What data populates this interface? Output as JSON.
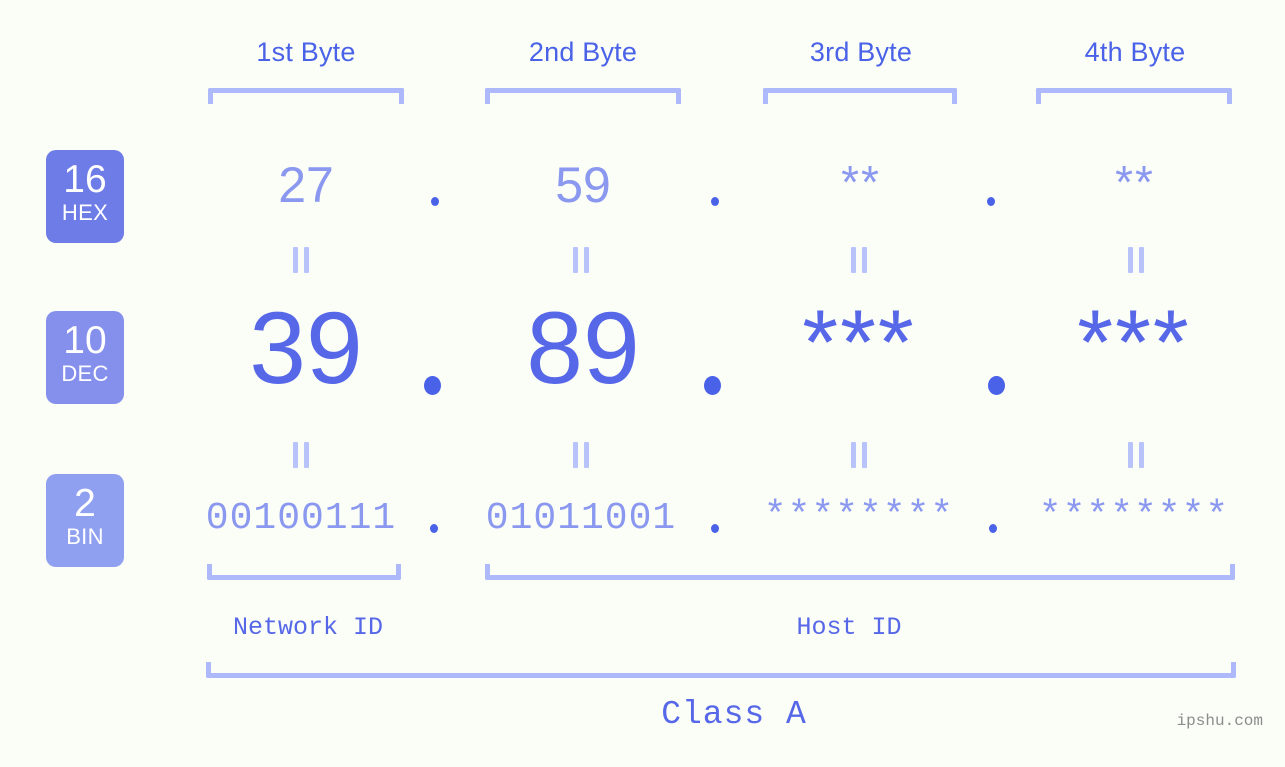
{
  "meta": {
    "background_color": "#fbfdf7",
    "accent_color": "#4a62e8",
    "light_accent_color": "#8a98ef",
    "bracket_color": "#aeb9fb"
  },
  "headers": {
    "byte1": "1st Byte",
    "byte2": "2nd Byte",
    "byte3": "3rd Byte",
    "byte4": "4th Byte"
  },
  "rows": {
    "hex": {
      "badge_number": "16",
      "badge_label": "HEX",
      "badge_color": "#6e7ce8",
      "values": [
        "27",
        "59",
        "**",
        "**"
      ],
      "separator": "."
    },
    "dec": {
      "badge_number": "10",
      "badge_label": "DEC",
      "badge_color": "#8490ec",
      "values": [
        "39",
        "89",
        "***",
        "***"
      ],
      "separator": "."
    },
    "bin": {
      "badge_number": "2",
      "badge_label": "BIN",
      "badge_color": "#90a0f1",
      "values": [
        "00100111",
        "01011001",
        "********",
        "********"
      ],
      "separator": "."
    }
  },
  "equals_marks": {
    "glyph": "=",
    "count_per_gap": 4
  },
  "footer": {
    "network_id_label": "Network ID",
    "host_id_label": "Host ID",
    "class_label": "Class A"
  },
  "watermark": {
    "text": "ipshu.com"
  }
}
